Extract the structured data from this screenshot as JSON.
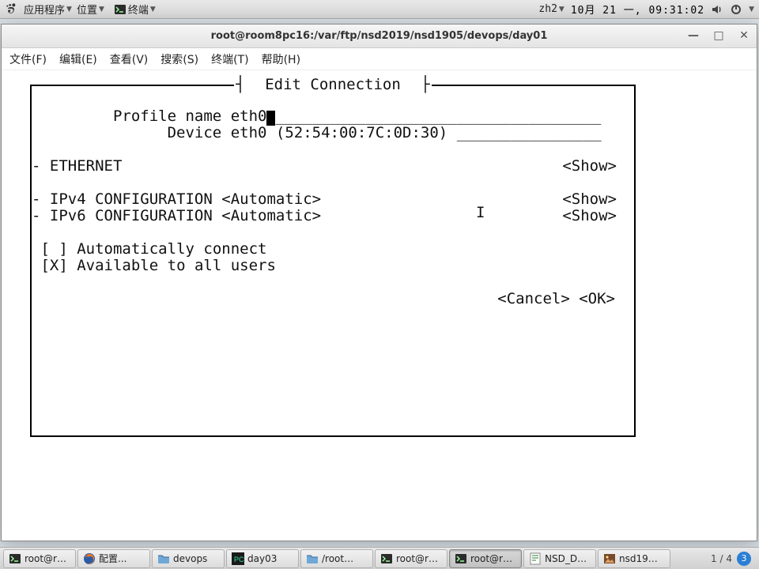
{
  "top_panel": {
    "applications": "应用程序",
    "places": "位置",
    "active_app": "终端",
    "input_method": "zh2",
    "date": "10月 21 一,",
    "time": "09:31:02"
  },
  "window": {
    "title": "root@room8pc16:/var/ftp/nsd2019/nsd1905/devops/day01"
  },
  "menu": {
    "file": "文件(F)",
    "edit": "编辑(E)",
    "view": "查看(V)",
    "search": "搜索(S)",
    "terminal": "终端(T)",
    "help": "帮助(H)"
  },
  "tui": {
    "title": "Edit Connection",
    "profile_label": "Profile name",
    "profile_value": "eth0",
    "profile_underscore": "____________________________________",
    "device_label": "Device",
    "device_value": "eth0",
    "device_mac": "(52:54:00:7C:0D:30)",
    "device_underscore": "________________",
    "ethernet": "ETHERNET",
    "show": "<Show>",
    "ipv4": "IPv4 CONFIGURATION",
    "ipv6": "IPv6 CONFIGURATION",
    "automatic": "<Automatic>",
    "auto_connect_mark": "[ ]",
    "auto_connect": "Automatically connect",
    "all_users_mark": "[X]",
    "all_users": "Available to all users",
    "cancel": "<Cancel>",
    "ok": "<OK>"
  },
  "taskbar": {
    "items": [
      {
        "label": "root@r…",
        "icon": "terminal"
      },
      {
        "label": "配置...",
        "icon": "firefox"
      },
      {
        "label": "devops",
        "icon": "folder"
      },
      {
        "label": "day03",
        "icon": "pycharm"
      },
      {
        "label": "/root…",
        "icon": "folder"
      },
      {
        "label": "root@r…",
        "icon": "terminal",
        "active": false
      },
      {
        "label": "root@r…",
        "icon": "terminal",
        "active": true
      },
      {
        "label": "NSD_D…",
        "icon": "gedit"
      },
      {
        "label": "nsd19…",
        "icon": "image"
      }
    ],
    "workspace": "1 / 4",
    "tray_num": "3"
  }
}
